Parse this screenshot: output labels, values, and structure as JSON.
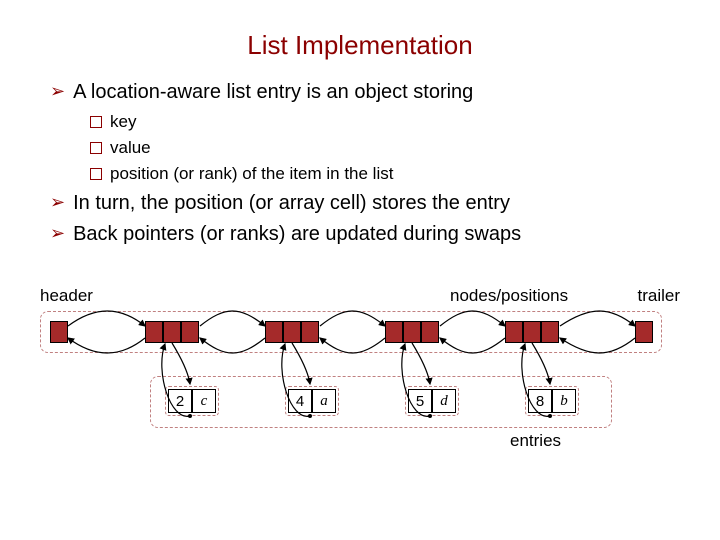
{
  "title": "List Implementation",
  "bullets": {
    "b1": "A location-aware list entry is an object storing",
    "sub1": "key",
    "sub2": "value",
    "sub3": "position (or rank) of the item in the list",
    "b2": "In turn, the position (or array cell) stores the entry",
    "b3": "Back pointers (or ranks) are updated during swaps"
  },
  "diagram": {
    "header_label": "header",
    "trailer_label": "trailer",
    "nodes_label": "nodes/positions",
    "entries_label": "entries",
    "entries": [
      {
        "key": "2",
        "val": "c"
      },
      {
        "key": "4",
        "val": "a"
      },
      {
        "key": "5",
        "val": "d"
      },
      {
        "key": "8",
        "val": "b"
      }
    ]
  }
}
